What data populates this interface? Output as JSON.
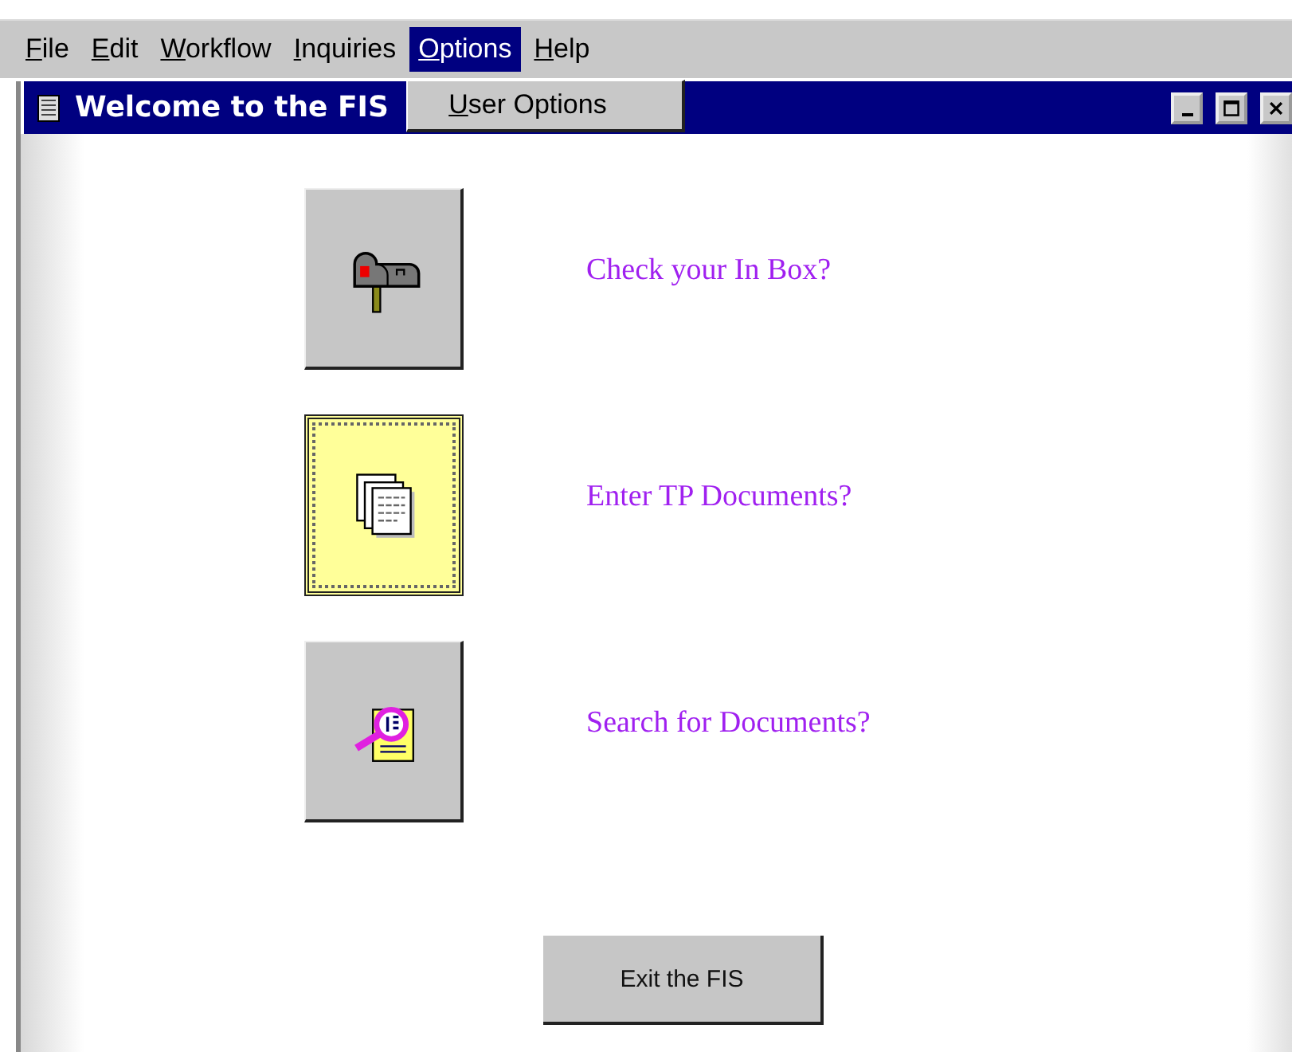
{
  "menu_bar": [
    {
      "label": "File",
      "selected": false
    },
    {
      "label": "Edit",
      "selected": false
    },
    {
      "label": "Workflow",
      "selected": false
    },
    {
      "label": "Inquiries",
      "selected": false
    },
    {
      "label": "Options",
      "selected": true,
      "dropdown": [
        "User Options"
      ]
    },
    {
      "label": "Help",
      "selected": false
    }
  ],
  "window": {
    "title": "Welcome to the FIS"
  },
  "actions": [
    {
      "kind": "inbox",
      "label": "Check your In Box?",
      "focused": false
    },
    {
      "kind": "documents",
      "label": "Enter TP Documents?",
      "focused": true
    },
    {
      "kind": "search",
      "label": "Search for Documents?",
      "focused": false
    }
  ],
  "exit_button": "Exit the FIS"
}
